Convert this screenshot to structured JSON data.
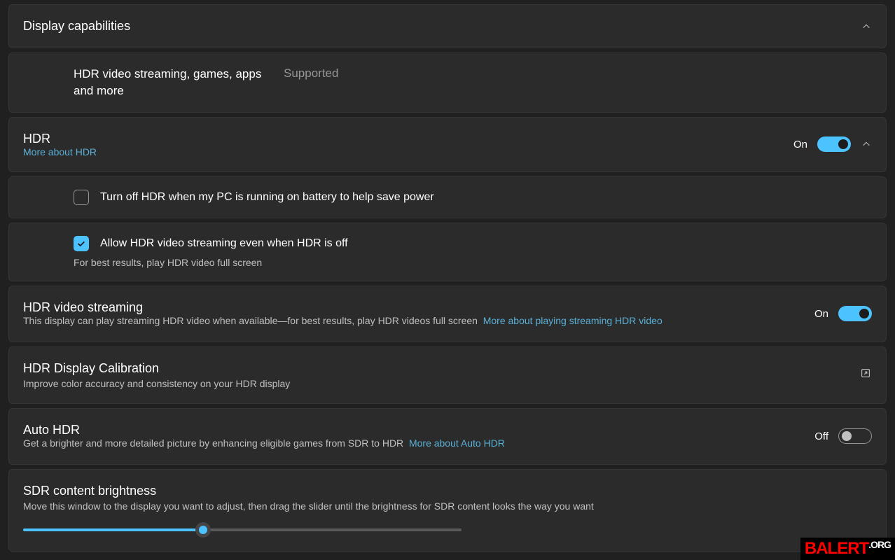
{
  "capabilities": {
    "header": "Display capabilities",
    "item_label": "HDR video streaming, games, apps and more",
    "item_value": "Supported"
  },
  "hdr": {
    "title": "HDR",
    "link": "More about HDR",
    "state_label": "On",
    "checkbox1": {
      "label": "Turn off HDR when my PC is running on battery to help save power",
      "checked": false
    },
    "checkbox2": {
      "label": "Allow HDR video streaming even when HDR is off",
      "hint": "For best results, play HDR video full screen",
      "checked": true
    }
  },
  "streaming": {
    "title": "HDR video streaming",
    "desc": "This display can play streaming HDR video when available—for best results, play HDR videos full screen",
    "link": "More about playing streaming HDR video",
    "state_label": "On"
  },
  "calibration": {
    "title": "HDR Display Calibration",
    "desc": "Improve color accuracy and consistency on your HDR display"
  },
  "autohdr": {
    "title": "Auto HDR",
    "desc": "Get a brighter and more detailed picture by enhancing eligible games from SDR to HDR",
    "link": "More about Auto HDR",
    "state_label": "Off"
  },
  "sdr": {
    "title": "SDR content brightness",
    "desc": "Move this window to the display you want to adjust, then drag the slider until the brightness for SDR content looks the way you want",
    "slider_percent": 41
  },
  "watermark": {
    "main": "BALERT",
    "suffix": ".ORG"
  }
}
